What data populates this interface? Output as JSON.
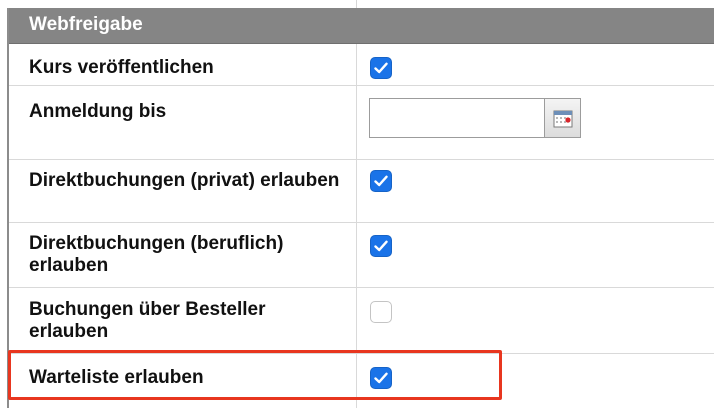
{
  "section": {
    "title": "Webfreigabe"
  },
  "rows": [
    {
      "label": "Kurs veröffentlichen",
      "checked": true
    },
    {
      "label": "Anmeldung bis",
      "date_value": ""
    },
    {
      "label": "Direktbuchungen (privat) erlauben",
      "checked": true
    },
    {
      "label": "Direktbuchungen (beruflich) erlauben",
      "checked": true
    },
    {
      "label": "Buchungen über Besteller erlauben",
      "checked": false
    },
    {
      "label": "Warteliste erlauben",
      "checked": true
    }
  ],
  "icons": {
    "checkmark": "checkmark-icon",
    "calendar": "calendar-icon"
  },
  "colors": {
    "header_bg": "#858585",
    "checkbox_checked": "#1a73e8",
    "highlight": "#e8361f"
  }
}
